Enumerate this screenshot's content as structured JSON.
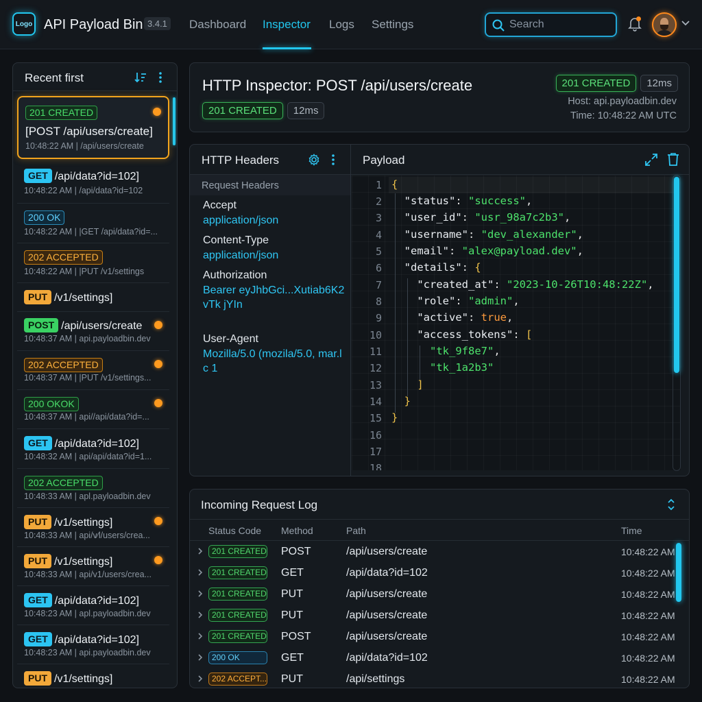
{
  "app": {
    "logo_text": "Logo",
    "title": "API Payload Bin",
    "version": "3.4.1"
  },
  "nav": [
    {
      "label": "Dashboard"
    },
    {
      "label": "Inspector"
    },
    {
      "label": "Logs"
    },
    {
      "label": "Settings"
    }
  ],
  "search": {
    "placeholder": "Search",
    "value": ""
  },
  "colors": {
    "accent": "#22c7ef",
    "selection": "#f2a41d",
    "success": "#4ade6a",
    "warning": "#ffb23c"
  },
  "sidebar": {
    "title": "Recent first",
    "requests": [
      {
        "badge": "201 CREATED",
        "badge_kind": "green",
        "text": "[POST /api/users/create]",
        "meta": "10:48:22 AM | /api/users/create",
        "dot": true,
        "selected": true
      },
      {
        "method": "GET",
        "method_kind": "get",
        "text": "/api/data?id=102]",
        "meta": "10:48:22 AM | /api/data?id=102",
        "dot": false
      },
      {
        "badge": "200 OK",
        "badge_kind": "blue",
        "meta": "10:48:22 AM | |GET /api/data?id=...",
        "dot": false
      },
      {
        "badge": "202 ACCEPTED",
        "badge_kind": "orange",
        "meta": "10:48:22 AM | |PUT /v1/settings",
        "dot": false
      },
      {
        "method": "PUT",
        "method_kind": "put",
        "text": "/v1/settings]",
        "meta": "",
        "dot": false
      },
      {
        "method": "POST",
        "method_kind": "post",
        "text": "/api/users/create",
        "meta": "10:48:37 AM | api.payloadbin.dev",
        "dot": true
      },
      {
        "badge": "202 ACCEPTED",
        "badge_kind": "orange",
        "meta": "10:48:37 AM | |PUT /v1/settings...",
        "dot": true
      },
      {
        "badge": "200 OKOK",
        "badge_kind": "green",
        "meta": "10:48:37 AM | api//api/data?id=...",
        "dot": true
      },
      {
        "method": "GET",
        "method_kind": "get",
        "text": "/api/data?id=102]",
        "meta": "10:48:32 AM | api/api/data?id=1...",
        "dot": false
      },
      {
        "badge": "202 ACCEPTED",
        "badge_kind": "green",
        "meta": "10:48:33 AM | apl.payloadbin.dev",
        "dot": false
      },
      {
        "method": "PUT",
        "method_kind": "put",
        "text": "/v1/settings]",
        "meta": "10:48:33 AM | api/v⁄l/users/crea...",
        "dot": true
      },
      {
        "method": "PUT",
        "method_kind": "put",
        "text": "/v1/settings]",
        "meta": "10:48:33 AM | api/v1/users/crea...",
        "dot": true
      },
      {
        "method": "GET",
        "method_kind": "get",
        "text": "/api/data?id=102]",
        "meta": "10:48:23 AM | apl.payloadbin.dev",
        "dot": false
      },
      {
        "method": "GET",
        "method_kind": "get",
        "text": "/api/data?id=102]",
        "meta": "10:48:23 AM | api.payloadbin.dev",
        "dot": false
      },
      {
        "method": "PUT",
        "method_kind": "put",
        "text": "/v1/settings]",
        "meta": "",
        "dot": false
      }
    ]
  },
  "inspector": {
    "title": "HTTP Inspector: POST /api/users/create",
    "status": "201 CREATED",
    "duration": "12ms",
    "host": "Host: api.payloadbin.dev",
    "time": "Time: 10:48:22 AM UTC"
  },
  "headers_panel": {
    "title": "HTTP Headers",
    "section_label": "Request Headers",
    "headers": [
      {
        "key": "Accept",
        "value": "application/json"
      },
      {
        "key": "Content-Type",
        "value": "application/json"
      },
      {
        "key": "Authorization",
        "value": "Bearer eyJhbGci...Xutiab6K2vTk jYIn"
      },
      {
        "key": "User-Agent",
        "value": "Mozilla/5.0 (mozila/5.0, mar.lc 1"
      }
    ]
  },
  "payload_panel": {
    "title": "Payload",
    "line_numbers": [
      "1",
      "2",
      "3",
      "4",
      "5",
      "6",
      "7",
      "8",
      "9",
      "10",
      "11",
      "12",
      "13",
      "14",
      "15",
      "16",
      "17",
      "18"
    ],
    "lines": [
      "{",
      "  \"status\": \"success\",",
      "  \"user_id\": \"usr_98a7c2b3\",",
      "  \"username\": \"dev_alexander\",",
      "  \"email\": \"alex@payload.dev\",",
      "  \"details\": {",
      "    \"created_at\": \"2023-10-26T10:48:22Z\",",
      "    \"role\": \"admin\",",
      "    \"active\": true,",
      "    \"access_tokens\": [",
      "      \"tk_9f8e7\",",
      "      \"tk_1a2b3\"",
      "    ]",
      "  }",
      "}"
    ]
  },
  "log": {
    "title": "Incoming Request Log",
    "columns": [
      "Status Code",
      "Method",
      "Path",
      "Time"
    ],
    "rows": [
      {
        "status": "201 CREATED",
        "kind": "green",
        "method": "POST",
        "path": "/api/users/create",
        "time": "10:48:22 AM"
      },
      {
        "status": "201 CREATED",
        "kind": "green",
        "method": "GET",
        "path": "/api/data?id=102",
        "time": "10:48:22 AM"
      },
      {
        "status": "201 CREATED",
        "kind": "green",
        "method": "PUT",
        "path": "/api/users/create",
        "time": "10:48:22 AM"
      },
      {
        "status": "201 CREATED",
        "kind": "green",
        "method": "PUT",
        "path": "/api/users/create",
        "time": "10:48:22 AM"
      },
      {
        "status": "201 CREATED",
        "kind": "green",
        "method": "POST",
        "path": "/api/users/create",
        "time": "10:48:22 AM"
      },
      {
        "status": "200 OK",
        "kind": "blue",
        "method": "GET",
        "path": "/api/data?id=102",
        "time": "10:48:22 AM"
      },
      {
        "status": "202 ACCEPT...",
        "kind": "orange",
        "method": "PUT",
        "path": "/api/settings",
        "time": "10:48:22 AM"
      }
    ]
  }
}
